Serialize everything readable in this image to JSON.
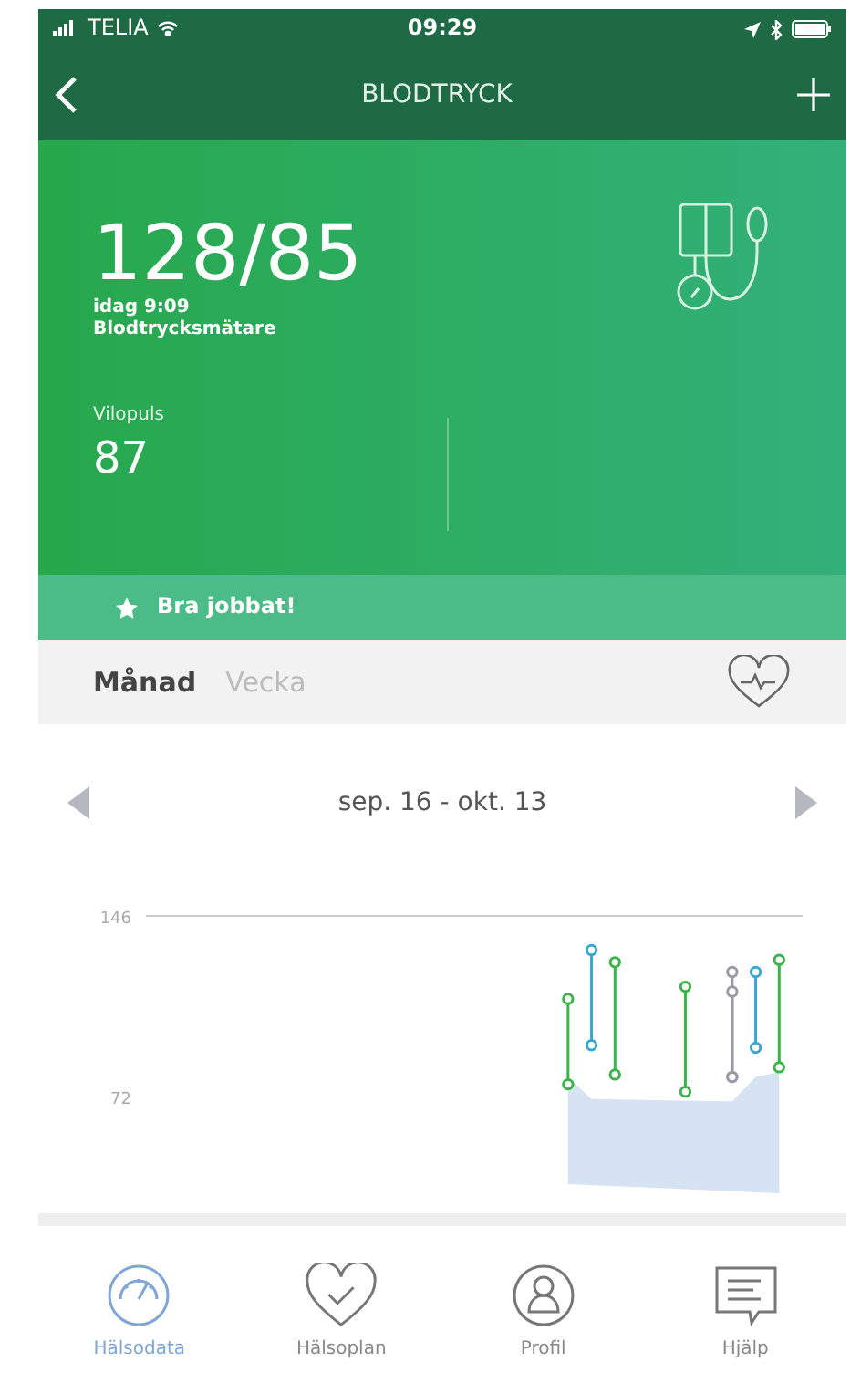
{
  "status_bar": {
    "carrier": "TELIA",
    "time": "09:29"
  },
  "nav": {
    "title": "BLODTRYCK"
  },
  "reading": {
    "value": "128/85",
    "time": "idag 9:09",
    "source": "Blodtrycksmätare"
  },
  "pulse": {
    "label": "Vilopuls",
    "value": "87"
  },
  "banner": {
    "text": "Bra jobbat!"
  },
  "tabs": [
    {
      "label": "Månad",
      "selected": true
    },
    {
      "label": "Vecka",
      "selected": false
    }
  ],
  "chart": {
    "range": "sep. 16 - okt. 13",
    "axis_labels": [
      "146",
      "72"
    ]
  },
  "bottom_nav": [
    {
      "label": "Hälsodata",
      "selected": true
    },
    {
      "label": "Hälsoplan",
      "selected": false
    },
    {
      "label": "Profil",
      "selected": false
    },
    {
      "label": "Hjälp",
      "selected": false
    }
  ]
}
